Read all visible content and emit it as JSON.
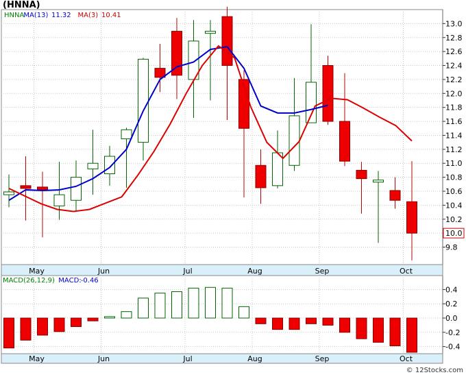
{
  "chart_data": [
    {
      "type": "candlestick",
      "title": "(HNNA)",
      "legend": [
        {
          "label": "HNNA",
          "value": "",
          "color": "#008000"
        },
        {
          "label": "MA(13)",
          "value": "11.32",
          "color": "#0000cc"
        },
        {
          "label": "MA(3)",
          "value": "10.41",
          "color": "#cc0000"
        }
      ],
      "months": [
        {
          "label": "May",
          "index": 1
        },
        {
          "label": "Jun",
          "index": 5
        },
        {
          "label": "Jul",
          "index": 10
        },
        {
          "label": "Aug",
          "index": 14
        },
        {
          "label": "Sep",
          "index": 18
        },
        {
          "label": "Oct",
          "index": 23
        }
      ],
      "ylim": [
        9.55,
        13.2
      ],
      "y_ticks": [
        "9.8",
        "10.0",
        "10.2",
        "10.4",
        "10.6",
        "10.8",
        "11.0",
        "11.2",
        "11.4",
        "11.6",
        "11.8",
        "12.0",
        "12.2",
        "12.4",
        "12.6",
        "12.8",
        "13.0"
      ],
      "last_price": "10.0",
      "grid": true,
      "candles": [
        {
          "o": 10.55,
          "h": 10.84,
          "l": 10.37,
          "c": 10.59
        },
        {
          "o": 10.68,
          "h": 11.1,
          "l": 10.18,
          "c": 10.64
        },
        {
          "o": 10.66,
          "h": 10.88,
          "l": 9.94,
          "c": 10.62
        },
        {
          "o": 10.39,
          "h": 11.02,
          "l": 10.19,
          "c": 10.55
        },
        {
          "o": 10.47,
          "h": 11.04,
          "l": 10.31,
          "c": 10.8
        },
        {
          "o": 10.92,
          "h": 11.48,
          "l": 10.55,
          "c": 11.0
        },
        {
          "o": 10.85,
          "h": 11.25,
          "l": 10.68,
          "c": 11.1
        },
        {
          "o": 11.35,
          "h": 11.51,
          "l": 10.65,
          "c": 11.48
        },
        {
          "o": 11.3,
          "h": 12.51,
          "l": 11.04,
          "c": 12.49
        },
        {
          "o": 12.36,
          "h": 12.71,
          "l": 12.02,
          "c": 12.23
        },
        {
          "o": 12.89,
          "h": 13.08,
          "l": 11.92,
          "c": 12.26
        },
        {
          "o": 12.2,
          "h": 13.05,
          "l": 11.65,
          "c": 12.75
        },
        {
          "o": 12.86,
          "h": 13.05,
          "l": 11.9,
          "c": 12.89
        },
        {
          "o": 13.1,
          "h": 13.24,
          "l": 11.62,
          "c": 12.4
        },
        {
          "o": 12.2,
          "h": 12.33,
          "l": 10.51,
          "c": 11.5
        },
        {
          "o": 10.97,
          "h": 11.2,
          "l": 10.42,
          "c": 10.65
        },
        {
          "o": 10.68,
          "h": 11.47,
          "l": 10.64,
          "c": 11.15
        },
        {
          "o": 10.97,
          "h": 12.22,
          "l": 10.89,
          "c": 11.68
        },
        {
          "o": 11.58,
          "h": 12.99,
          "l": 11.59,
          "c": 12.16
        },
        {
          "o": 12.4,
          "h": 12.54,
          "l": 11.55,
          "c": 11.6
        },
        {
          "o": 11.6,
          "h": 12.29,
          "l": 10.96,
          "c": 11.03
        },
        {
          "o": 10.9,
          "h": 11.02,
          "l": 10.28,
          "c": 10.78
        },
        {
          "o": 10.73,
          "h": 10.89,
          "l": 9.86,
          "c": 10.76
        },
        {
          "o": 10.61,
          "h": 10.8,
          "l": 10.35,
          "c": 10.47
        },
        {
          "o": 10.45,
          "h": 11.03,
          "l": 9.61,
          "c": 10.0
        }
      ],
      "series": [
        {
          "name": "MA(13)",
          "color": "#0000cc",
          "start": 0,
          "end": 13,
          "values": [
            10.47,
            10.62,
            10.61,
            10.62,
            10.67,
            10.78,
            10.94,
            11.2,
            11.75,
            12.2,
            12.38,
            12.45,
            12.63,
            12.67
          ]
        },
        {
          "name": "MA(3)",
          "color": "#dd0000",
          "start": 0,
          "end": 24,
          "values": [
            10.64,
            10.53,
            10.42,
            10.34,
            10.31,
            10.34,
            10.43,
            10.52,
            10.83,
            11.17,
            11.56,
            12.0,
            12.4,
            12.68,
            12.51,
            11.81,
            11.3,
            11.07,
            11.31,
            11.82,
            11.93,
            11.91,
            11.79,
            11.66,
            11.54,
            11.32
          ]
        },
        {
          "name": "MA(13) recent",
          "color": "#0000cc",
          "start": 13,
          "end": 19,
          "values": [
            12.67,
            12.36,
            11.82,
            11.72,
            11.72,
            11.77,
            11.83
          ]
        }
      ]
    },
    {
      "type": "bar",
      "title": "MACD(26,12,9)",
      "legend": [
        {
          "label": "MACD(26,12,9)",
          "value": "",
          "color": "#008000"
        },
        {
          "label": "MACD:",
          "value": "-0.46",
          "color": "#0000cc"
        }
      ],
      "ylim": [
        -0.5,
        0.5
      ],
      "y_ticks": [
        "0.4",
        "0.2",
        "0.0",
        "-0.2",
        "-0.4"
      ],
      "values": [
        -0.42,
        -0.31,
        -0.24,
        -0.19,
        -0.12,
        -0.04,
        0.02,
        0.09,
        0.28,
        0.35,
        0.37,
        0.42,
        0.43,
        0.42,
        0.16,
        -0.08,
        -0.16,
        -0.16,
        -0.08,
        -0.1,
        -0.2,
        -0.29,
        -0.34,
        -0.39,
        -0.48
      ]
    }
  ],
  "x_axis": {
    "months": [
      "May",
      "Jun",
      "Jul",
      "Aug",
      "Sep",
      "Oct"
    ]
  },
  "watermark": "© 12Stocks.com"
}
